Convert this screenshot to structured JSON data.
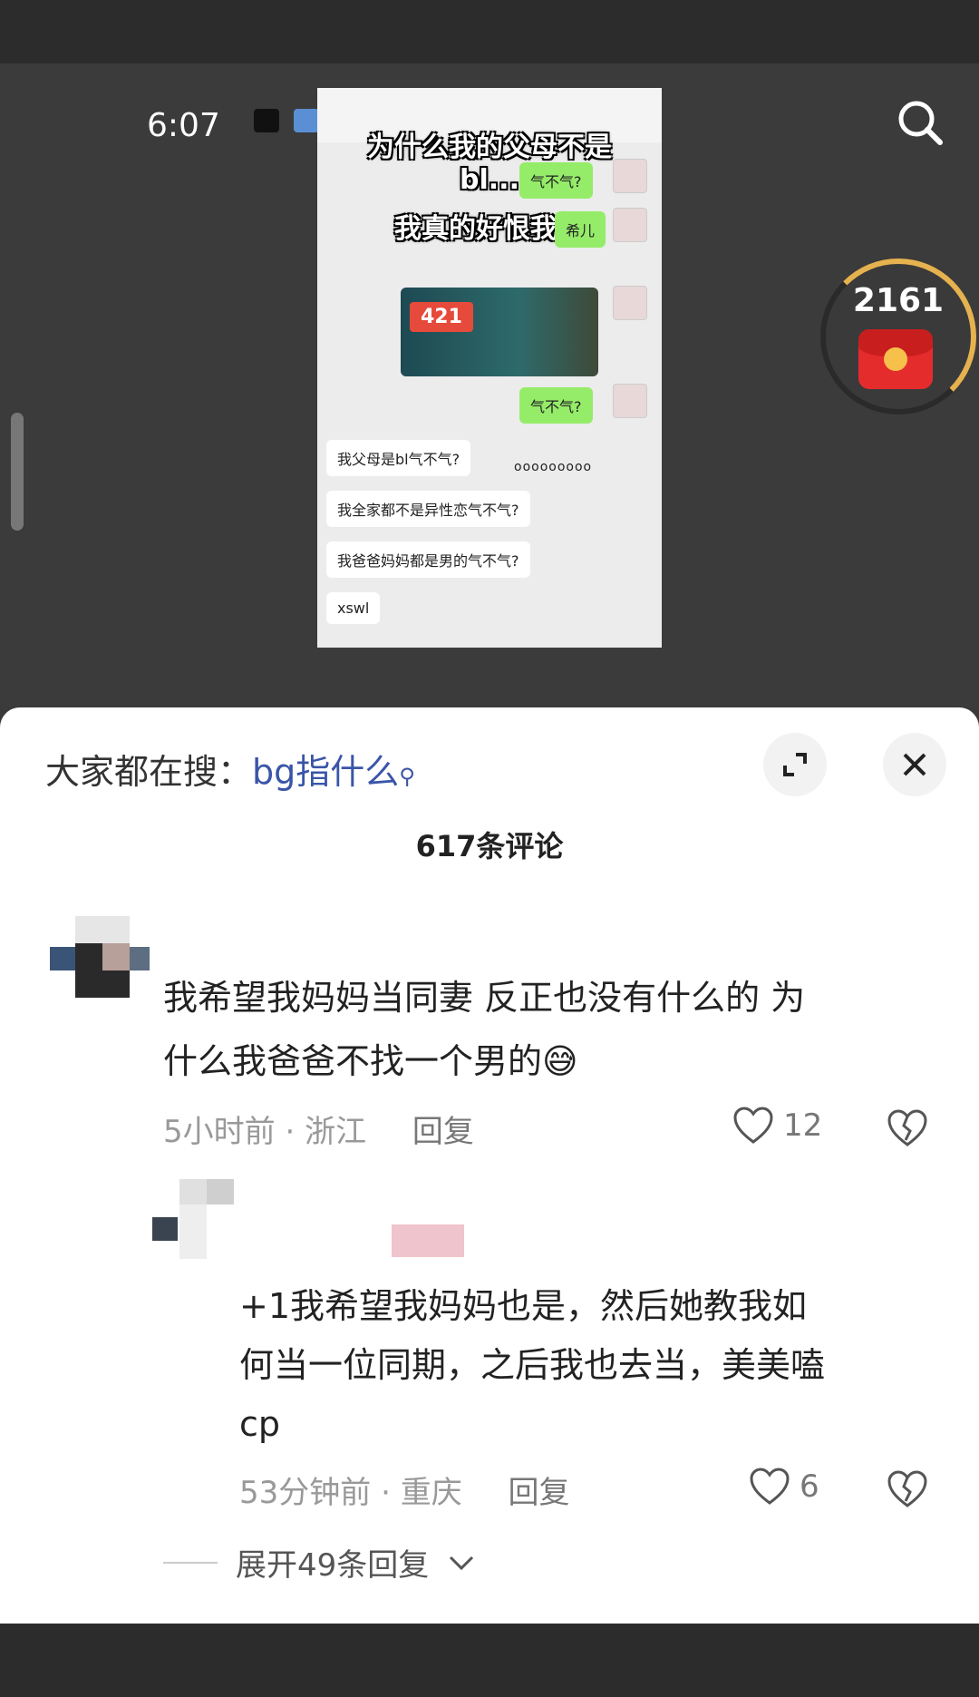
{
  "status": {
    "time": "6:07"
  },
  "video": {
    "caption": [
      "为什么我的父母不是",
      "bl...",
      "我真的好恨我妈"
    ],
    "chat": {
      "green1": "气不气?",
      "green2": "希儿",
      "green3": "气不气?",
      "card_number": "421",
      "white1": "我父母是bl气不气?",
      "dots": "ooooooooo",
      "white2": "我全家都不是异性恋气不气?",
      "white3": "我爸爸妈妈都是男的气不气?",
      "white4": "xswl"
    },
    "red_packet_count": "2161"
  },
  "panel": {
    "hot_search_label": "大家都在搜：",
    "hot_search_keyword": "bg指什么",
    "comment_count": "617条评论"
  },
  "comments": [
    {
      "lines": [
        "我希望我妈妈当同妻 反正也没有什么的 为",
        "什么我爸爸不找一个男的😅"
      ],
      "time": "5小时前",
      "location": "浙江",
      "reply_label": "回复",
      "likes": "12"
    },
    {
      "lines": [
        "+1我希望我妈妈也是，然后她教我如",
        "何当一位同期，之后我也去当，美美嗑",
        "cp"
      ],
      "time": "53分钟前",
      "location": "重庆",
      "reply_label": "回复",
      "likes": "6"
    }
  ],
  "expand_replies": "展开49条回复"
}
